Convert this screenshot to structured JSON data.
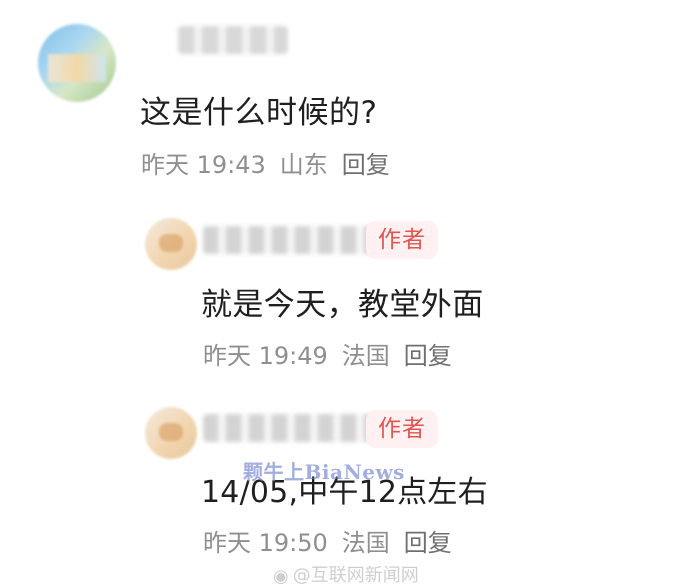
{
  "comments": [
    {
      "text": "这是什么时候的?",
      "time": "昨天 19:43",
      "location": "山东",
      "reply_label": "回复"
    },
    {
      "badge": "作者",
      "text": "就是今天，教堂外面",
      "time": "昨天 19:49",
      "location": "法国",
      "reply_label": "回复"
    },
    {
      "badge": "作者",
      "text": "14/05,中午12点左右",
      "time": "昨天 19:50",
      "location": "法国",
      "reply_label": "回复"
    }
  ],
  "watermarks": {
    "overlay": "颗牛上BiaNews",
    "source": "@互联网新闻网"
  },
  "icons": {
    "source_mark": "weibo-icon"
  }
}
